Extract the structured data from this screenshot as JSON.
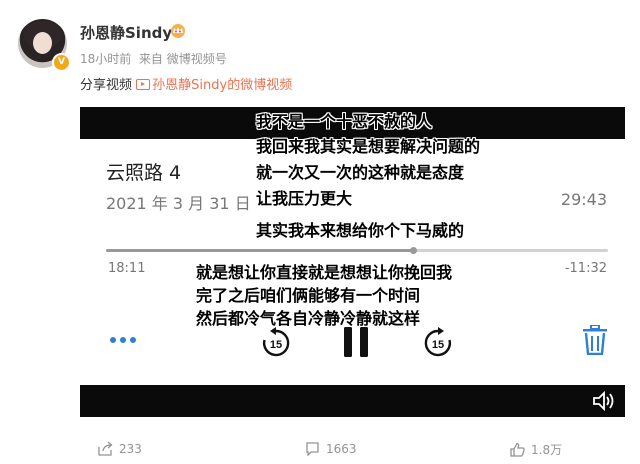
{
  "user": {
    "name": "孙恩静Sindy",
    "time": "18小时前",
    "source": "来自 微博视频号"
  },
  "share": {
    "label": "分享视频",
    "link": "孙恩静Sindy的微博视频"
  },
  "recording": {
    "title": "云照路 4",
    "date": "2021 年 3 月 31 日",
    "duration": "29:43",
    "elapsed": "18:11",
    "remaining": "-11:32",
    "skip_back": "15",
    "skip_forward": "15",
    "progress": 0.612
  },
  "subtitles": [
    "我不是一个十恶不赦的人",
    "我回来我其实是想要解决问题的",
    "就一次又一次的这种就是态度",
    "让我压力更大",
    "其实我本来想给你个下马威的",
    "就是想让你直接就是想想让你挽回我",
    "完了之后咱们俩能够有一个时间",
    "然后都冷气各自冷静冷静就这样"
  ],
  "actions": {
    "share_count": "233",
    "comment_count": "1663",
    "like_count": "1.8万"
  },
  "colors": {
    "accent": "#eb7350",
    "badge": "#f3a81c",
    "trash": "#2f7fd6"
  }
}
